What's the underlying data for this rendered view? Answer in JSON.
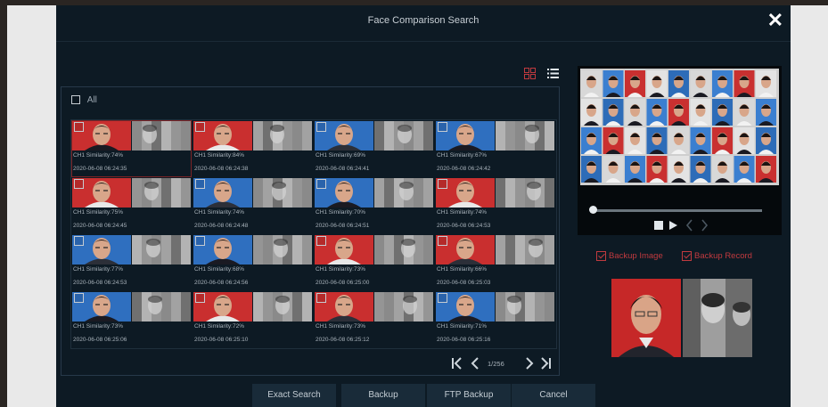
{
  "window": {
    "title": "Face Comparison Search",
    "close_icon": "✕"
  },
  "view_modes": [
    "grid-view-icon",
    "list-view-icon"
  ],
  "select_all_label": "All",
  "results": [
    {
      "caption": "CH1  Similarity:74%",
      "time": "2020-06-08 06:24:35",
      "selected": true
    },
    {
      "caption": "CH1  Similarity:84%",
      "time": "2020-06-08 06:24:38"
    },
    {
      "caption": "CH1  Similarity:69%",
      "time": "2020-06-08 06:24:41"
    },
    {
      "caption": "CH1  Similarity:67%",
      "time": "2020-06-08 06:24:42"
    },
    {
      "caption": "CH1  Similarity:75%",
      "time": "2020-06-08 06:24:45"
    },
    {
      "caption": "CH1  Similarity:74%",
      "time": "2020-06-08 06:24:48"
    },
    {
      "caption": "CH1  Similarity:70%",
      "time": "2020-06-08 06:24:51"
    },
    {
      "caption": "CH1  Similarity:74%",
      "time": "2020-06-08 06:24:53"
    },
    {
      "caption": "CH1  Similarity:77%",
      "time": "2020-06-08 06:24:53"
    },
    {
      "caption": "CH1  Similarity:68%",
      "time": "2020-06-08 06:24:56"
    },
    {
      "caption": "CH1  Similarity:73%",
      "time": "2020-06-08 06:25:00"
    },
    {
      "caption": "CH1  Similarity:66%",
      "time": "2020-06-08 06:25:03"
    },
    {
      "caption": "CH1  Similarity:73%",
      "time": "2020-06-08 06:25:06"
    },
    {
      "caption": "CH1  Similarity:72%",
      "time": "2020-06-08 06:25:10"
    },
    {
      "caption": "CH1  Similarity:73%",
      "time": "2020-06-08 06:25:12"
    },
    {
      "caption": "CH1  Similarity:71%",
      "time": "2020-06-08 06:25:16"
    }
  ],
  "pagination": {
    "page_info": "1/256"
  },
  "preview": {
    "playback_progress": 0.0
  },
  "backup_options": [
    {
      "label": "Backup Image",
      "checked": true
    },
    {
      "label": "Backup Record",
      "checked": true
    }
  ],
  "buttons": {
    "exact_search": "Exact Search",
    "backup": "Backup",
    "ftp_backup": "FTP Backup",
    "cancel": "Cancel"
  },
  "colors": {
    "background": "#0d1a24",
    "accent": "#c03a3f",
    "button": "#192b39",
    "selection": "#7a2326"
  }
}
